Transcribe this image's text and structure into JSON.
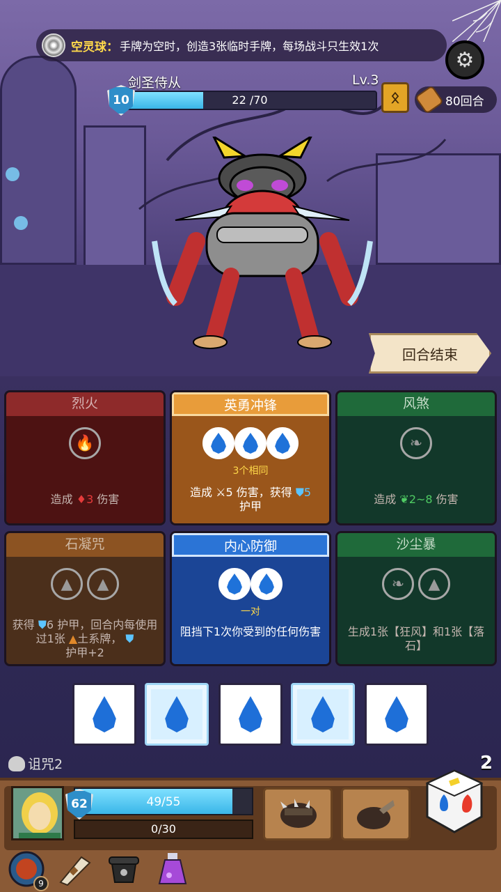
{
  "passive": {
    "name": "空灵球：",
    "description": "手牌为空时，创造3张临时手牌，每场战斗只生效1次"
  },
  "enemy": {
    "name": "剑圣侍从",
    "level": "Lv.3",
    "shield": "10",
    "hp_text": "22 /70",
    "hp_fraction": 0.314
  },
  "turns": "80回合",
  "end_turn_label": "回合结束",
  "cards": {
    "c1": {
      "title": "烈火",
      "desc_pre": "造成",
      "desc_num": "3",
      "desc_post": "伤害"
    },
    "c2": {
      "title": "英勇冲锋",
      "note": "3个相同",
      "desc_a": "造成",
      "desc_b": "5 伤害，获得",
      "desc_c": "5",
      "desc_d": "护甲"
    },
    "c3": {
      "title": "风煞",
      "desc_pre": "造成",
      "desc_num": "2~8",
      "desc_post": "伤害"
    },
    "c4": {
      "title": "石凝咒",
      "desc_a": "获得",
      "desc_b": "6 护甲，回合内每使用过1张",
      "desc_c": "土系牌，",
      "desc_d": "护甲+2"
    },
    "c5": {
      "title": "内心防御",
      "note": "一对",
      "desc": "阻挡下1次你受到的任何伤害"
    },
    "c6": {
      "title": "沙尘暴",
      "desc": "生成1张【狂风】和1张【落石】"
    }
  },
  "curse": "诅咒2",
  "dice_count": "2",
  "player": {
    "shield": "62",
    "hp_text": "49/55",
    "hp_fraction": 0.89,
    "xp_text": "0/30"
  },
  "items": {
    "bowl_count": "9"
  },
  "icons": {
    "passive": "swirl-orb-icon",
    "settings": "gear-icon",
    "turns": "scroll-icon",
    "rune": "rune-card-icon",
    "curse": "skull-icon"
  },
  "colors": {
    "water": "#1e6fd8",
    "hp": "#3ab6e8",
    "accent_gold": "#ffd94a"
  }
}
